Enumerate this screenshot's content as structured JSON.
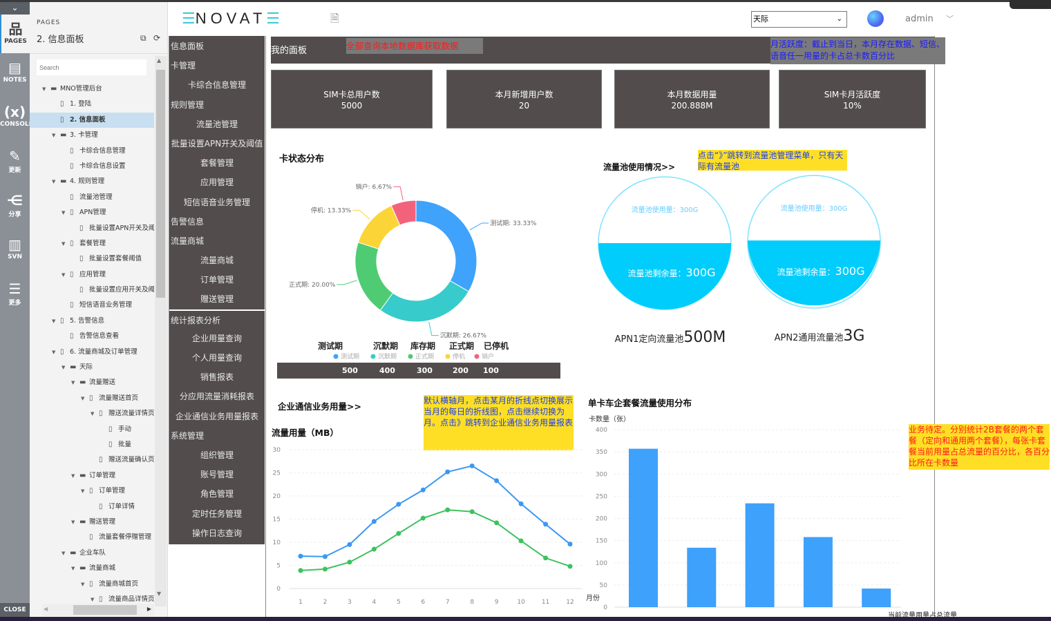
{
  "rail": {
    "items": [
      {
        "label": "PAGES",
        "icon": "sitemap-icon",
        "glyph": "品"
      },
      {
        "label": "NOTES",
        "icon": "notes-icon",
        "glyph": "▤"
      },
      {
        "label": "CONSOLE",
        "icon": "variable-icon",
        "glyph": "(x)"
      },
      {
        "label": "更新",
        "icon": "pencil-icon",
        "glyph": "✎"
      },
      {
        "label": "分享",
        "icon": "share-icon",
        "glyph": "⋲"
      },
      {
        "label": "SVN",
        "icon": "server-icon",
        "glyph": "▥"
      },
      {
        "label": "更多",
        "icon": "list-icon",
        "glyph": "☰"
      }
    ],
    "close": "CLOSE"
  },
  "pages_panel": {
    "header": "PAGES",
    "current": "2. 信息面板",
    "search_placeholder": "Search",
    "tree": [
      {
        "label": "MNO管理后台",
        "level": 0,
        "type": "folder",
        "expanded": true
      },
      {
        "label": "1. 登陆",
        "level": 1,
        "type": "page"
      },
      {
        "label": "2. 信息面板",
        "level": 1,
        "type": "page",
        "selected": true
      },
      {
        "label": "3. 卡管理",
        "level": 1,
        "type": "folder",
        "expanded": true
      },
      {
        "label": "卡综合信息管理",
        "level": 2,
        "type": "page"
      },
      {
        "label": "卡综合信息设置",
        "level": 2,
        "type": "page"
      },
      {
        "label": "4. 规则管理",
        "level": 1,
        "type": "folder",
        "expanded": true
      },
      {
        "label": "流量池管理",
        "level": 2,
        "type": "page"
      },
      {
        "label": "APN管理",
        "level": 2,
        "type": "page",
        "expanded": true
      },
      {
        "label": "批量设置APN开关及阈",
        "level": 3,
        "type": "page"
      },
      {
        "label": "套餐管理",
        "level": 2,
        "type": "page",
        "expanded": true
      },
      {
        "label": "批量设置套餐阈值",
        "level": 3,
        "type": "page"
      },
      {
        "label": "应用管理",
        "level": 2,
        "type": "page",
        "expanded": true
      },
      {
        "label": "批量设置应用开关及阈",
        "level": 3,
        "type": "page"
      },
      {
        "label": "短信语音业务管理",
        "level": 2,
        "type": "page"
      },
      {
        "label": "5. 告警信息",
        "level": 1,
        "type": "page",
        "expanded": true
      },
      {
        "label": "告警信息查看",
        "level": 2,
        "type": "page"
      },
      {
        "label": "6. 流量商城及订单管理",
        "level": 1,
        "type": "page",
        "expanded": true
      },
      {
        "label": "天际",
        "level": 2,
        "type": "folder",
        "expanded": true
      },
      {
        "label": "流量赠送",
        "level": 3,
        "type": "folder",
        "expanded": true
      },
      {
        "label": "流量赠送首页",
        "level": 4,
        "type": "page",
        "expanded": true
      },
      {
        "label": "赠送流量详情页",
        "level": 5,
        "type": "page",
        "expanded": true
      },
      {
        "label": "手动",
        "level": 6,
        "type": "page"
      },
      {
        "label": "批量",
        "level": 6,
        "type": "page"
      },
      {
        "label": "赠送流量确认页",
        "level": 5,
        "type": "page"
      },
      {
        "label": "订单管理",
        "level": 3,
        "type": "folder",
        "expanded": true
      },
      {
        "label": "订单管理",
        "level": 4,
        "type": "page",
        "expanded": true
      },
      {
        "label": "订单详情",
        "level": 5,
        "type": "page"
      },
      {
        "label": "赠送管理",
        "level": 3,
        "type": "folder",
        "expanded": true
      },
      {
        "label": "流量套餐停赠管理",
        "level": 4,
        "type": "page"
      },
      {
        "label": "企业车队",
        "level": 2,
        "type": "folder",
        "expanded": true
      },
      {
        "label": "流量商城",
        "level": 3,
        "type": "folder",
        "expanded": true
      },
      {
        "label": "流量商城首页",
        "level": 4,
        "type": "page",
        "expanded": true
      },
      {
        "label": "流量商品详情页",
        "level": 5,
        "type": "page",
        "expanded": true
      }
    ]
  },
  "header": {
    "logo": "NOVAT",
    "org_select": "天际",
    "user": "admin"
  },
  "nav": [
    {
      "label": "信息面板",
      "kind": "grp"
    },
    {
      "label": "卡管理",
      "kind": "grp"
    },
    {
      "label": "卡综合信息管理",
      "kind": "sub"
    },
    {
      "label": "规则管理",
      "kind": "grp"
    },
    {
      "label": "流量池管理",
      "kind": "sub"
    },
    {
      "label": "批量设置APN开关及阈值",
      "kind": "sub"
    },
    {
      "label": "套餐管理",
      "kind": "sub"
    },
    {
      "label": "应用管理",
      "kind": "sub"
    },
    {
      "label": "短信语音业务管理",
      "kind": "sub"
    },
    {
      "label": "告警信息",
      "kind": "grp"
    },
    {
      "label": "流量商城",
      "kind": "grp"
    },
    {
      "label": "流量商城",
      "kind": "sub"
    },
    {
      "label": "订单管理",
      "kind": "sub"
    },
    {
      "label": "赠送管理",
      "kind": "sub"
    },
    {
      "label": "统计报表分析",
      "kind": "grp",
      "divider": true
    },
    {
      "label": "企业用量查询",
      "kind": "sub"
    },
    {
      "label": "个人用量查询",
      "kind": "sub"
    },
    {
      "label": "销售报表",
      "kind": "sub"
    },
    {
      "label": "分应用流量消耗报表",
      "kind": "sub"
    },
    {
      "label": "企业通信业务用量报表",
      "kind": "sub"
    },
    {
      "label": "系统管理",
      "kind": "grp"
    },
    {
      "label": "组织管理",
      "kind": "sub"
    },
    {
      "label": "账号管理",
      "kind": "sub"
    },
    {
      "label": "角色管理",
      "kind": "sub"
    },
    {
      "label": "定时任务管理",
      "kind": "sub"
    },
    {
      "label": "操作日志查询",
      "kind": "sub"
    }
  ],
  "dashboard": {
    "title": "我的面板",
    "notes": {
      "data_source": "全部查询本地数据库获取数据",
      "activity": "月活跃度：截止到当日，本月存在数据、短信、语音任一用量的卡占总卡数百分比",
      "pool_jump": "点击“》”跳转到流量池管理菜单，只有天际有流量池",
      "line_hint": "默认横轴月，点击某月的折线点切换展示当月的每日的折线图，点击继续切换为月。点击》跳转到企业通信业务用量报表",
      "bar_hint": "业务待定。分别统计2B套餐的两个套餐（定向和通用两个套餐），每张卡套餐当前用量占总流量的百分比，各百分比所在卡数量"
    },
    "cards": [
      {
        "label": "SIM卡总用户数",
        "value": "5000"
      },
      {
        "label": "本月新增用户数",
        "value": "20"
      },
      {
        "label": "本月数据用量",
        "value": "200.888M"
      },
      {
        "label": "SIM卡月活跃度",
        "value": "10%"
      }
    ],
    "pool": {
      "title": "流量池使用情况>>",
      "pools": [
        {
          "used_label": "流量池使用量：300G",
          "remain_label": "流量池剩余量：",
          "remain_value": "300G",
          "name": "APN1定向流量池",
          "size": "500M",
          "fill_fraction": 0.5
        },
        {
          "used_label": "流量池使用量：300G",
          "remain_label": "流量池剩余量：",
          "remain_value": "300G",
          "name": "APN2通用流量池",
          "size": "3G",
          "fill_fraction": 0.51
        }
      ],
      "water_color": "#00cdfc"
    },
    "legend_bar": {
      "headings": [
        "测试期",
        "沉默期",
        "库存期",
        "正式期",
        "已停机"
      ],
      "values": [
        "500",
        "400",
        "300",
        "200",
        "100"
      ]
    }
  },
  "chart_data": [
    {
      "type": "pie",
      "title": "卡状态分布",
      "donut": true,
      "slices": [
        {
          "name": "测试期",
          "value": 33.33,
          "label": "测试期: 33.33%",
          "color": "#3fa2fb"
        },
        {
          "name": "沉默期",
          "value": 26.67,
          "label": "沉默期: 26.67%",
          "color": "#37cbcb"
        },
        {
          "name": "正式期",
          "value": 20.0,
          "label": "正式期: 20.00%",
          "color": "#4fcb74"
        },
        {
          "name": "停机",
          "value": 13.33,
          "label": "停机: 13.33%",
          "color": "#fbd437"
        },
        {
          "name": "销户",
          "value": 6.67,
          "label": "销户: 6.67%",
          "color": "#f2637b"
        }
      ],
      "legend": "bottom"
    },
    {
      "type": "line",
      "title": "企业通信业务用量>>",
      "ylabel": "流量用量（MB）",
      "x": [
        1,
        2,
        3,
        4,
        5,
        6,
        7,
        8,
        9,
        10,
        11,
        12
      ],
      "ylim": [
        0,
        30
      ],
      "yticks": [
        0,
        5,
        10,
        15,
        20,
        25,
        30
      ],
      "grid": true,
      "series": [
        {
          "values": [
            7.0,
            6.9,
            9.5,
            14.5,
            18.2,
            21.3,
            25.2,
            26.5,
            23.3,
            18.3,
            13.9,
            9.6
          ],
          "color": "#3a98f5"
        },
        {
          "values": [
            3.9,
            4.2,
            5.7,
            8.5,
            11.9,
            15.2,
            17.0,
            16.6,
            14.2,
            10.3,
            6.6,
            4.8
          ],
          "color": "#3dc25e"
        }
      ]
    },
    {
      "type": "bar",
      "title": "单卡车企套餐流量使用分布",
      "ylabel": "卡数量（张）",
      "xlabel": "当前流量用量占总流量",
      "ylabel2": "月份",
      "values": [
        357,
        134,
        234,
        158,
        42
      ],
      "ylim": [
        0,
        400
      ],
      "yticks": [
        0,
        50,
        100,
        150,
        200,
        250,
        300,
        350,
        400
      ],
      "color": "#3ea1fb",
      "grid": true
    }
  ]
}
